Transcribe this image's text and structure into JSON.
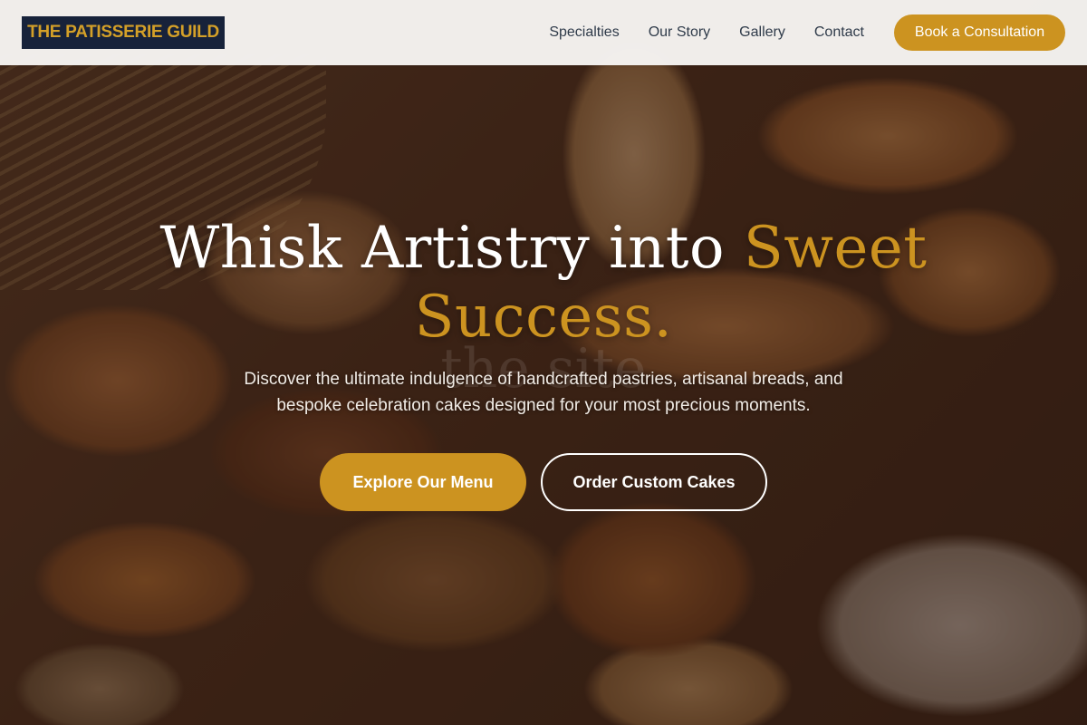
{
  "brand": {
    "logo_text": "THE PATISSERIE GUILD"
  },
  "nav": {
    "items": [
      {
        "label": "Specialties"
      },
      {
        "label": "Our Story"
      },
      {
        "label": "Gallery"
      },
      {
        "label": "Contact"
      }
    ],
    "cta_label": "Book a Consultation"
  },
  "hero": {
    "headline_main": "Whisk Artistry into ",
    "headline_accent": "Sweet Success.",
    "watermark": "the site",
    "subtitle": "Discover the ultimate indulgence of handcrafted pastries, artisanal breads, and bespoke celebration cakes designed for your most precious moments.",
    "primary_button": "Explore Our Menu",
    "secondary_button": "Order Custom Cakes"
  },
  "colors": {
    "accent": "#cc9320",
    "logo_bg": "#17223a",
    "nav_text": "#2f3b4a",
    "header_bg": "#f6f4f2"
  }
}
